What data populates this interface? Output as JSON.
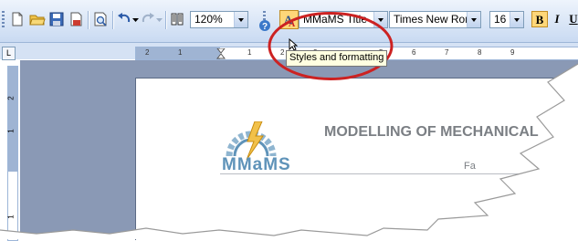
{
  "toolbar": {
    "zoom": "120%",
    "style": "MMaMS Title",
    "font": "Times New Roman",
    "size": "16",
    "bold": "B",
    "italic": "I",
    "underline": "U"
  },
  "tooltip": "Styles and formatting",
  "ruler": {
    "tab_selector": "L",
    "ticks": [
      "2",
      "1",
      "1",
      "2",
      "3",
      "4",
      "5",
      "6",
      "7",
      "8",
      "9"
    ],
    "vticks": [
      "2",
      "1",
      "1"
    ]
  },
  "document": {
    "logo": "MMaMS",
    "heading": "MODELLING OF MECHANICAL",
    "subline": "Fa"
  },
  "colors": {
    "ribbon": "#c9daf2",
    "annotation": "#cc2222",
    "logo": "#5f93b9"
  }
}
